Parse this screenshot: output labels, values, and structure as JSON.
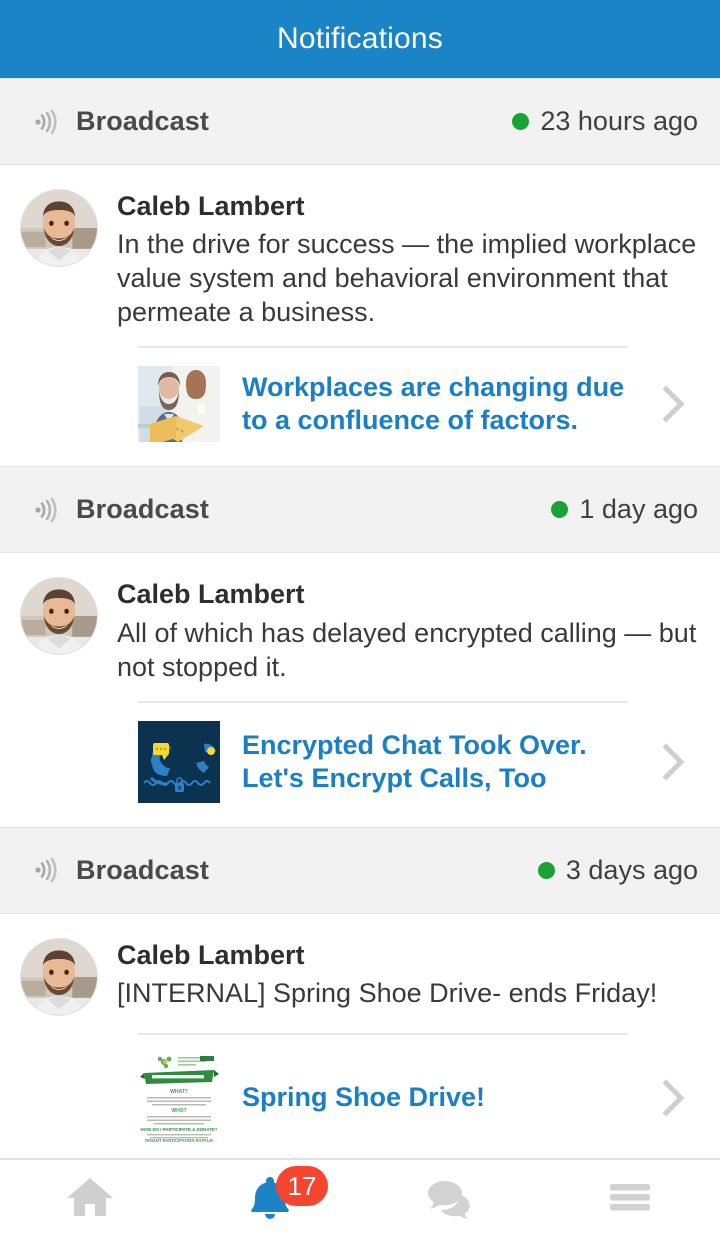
{
  "header": {
    "title": "Notifications",
    "background_color": "#1b84c6",
    "text_color": "#ffffff"
  },
  "colors": {
    "accent_blue": "#1b7fc4",
    "status_green": "#1aa335",
    "badge_red": "#f4452e",
    "band_gray": "#f2f2f2",
    "link_blue": "#1b7fc4"
  },
  "notifications": [
    {
      "kind_label": "Broadcast",
      "kind_icon": "broadcast-icon",
      "status_dot": "unread-dot",
      "time_ago": "23 hours ago",
      "author": "Caleb Lambert",
      "avatar_icon": "user-avatar",
      "message": "In the drive for success — the implied workplace value system and behavioral environment that permeate a business.",
      "attachment": {
        "thumbnail_icon": "office-women-photo-thumbnail",
        "title": "Workplaces are changing due to a confluence of factors.",
        "chevron_icon": "chevron-right-icon"
      }
    },
    {
      "kind_label": "Broadcast",
      "kind_icon": "broadcast-icon",
      "status_dot": "unread-dot",
      "time_ago": "1 day ago",
      "author": "Caleb Lambert",
      "avatar_icon": "user-avatar",
      "message": "All of which has delayed encrypted calling — but not stopped it.",
      "attachment": {
        "thumbnail_icon": "encrypted-phone-illustration-thumbnail",
        "title": "Encrypted Chat Took Over. Let's Encrypt Calls, Too",
        "chevron_icon": "chevron-right-icon"
      }
    },
    {
      "kind_label": "Broadcast",
      "kind_icon": "broadcast-icon",
      "status_dot": "unread-dot",
      "time_ago": "3 days ago",
      "author": "Caleb Lambert",
      "avatar_icon": "user-avatar",
      "message": "[INTERNAL] Spring Shoe Drive- ends Friday!",
      "attachment": {
        "thumbnail_icon": "shoe-drive-flyer-thumbnail",
        "title": "Spring Shoe Drive!",
        "chevron_icon": "chevron-right-icon"
      }
    }
  ],
  "bottom_nav": {
    "items": [
      {
        "name": "home",
        "icon": "home-icon",
        "active": false,
        "badge": null
      },
      {
        "name": "notifications",
        "icon": "bell-icon",
        "active": true,
        "badge": "17"
      },
      {
        "name": "messages",
        "icon": "chat-bubbles-icon",
        "active": false,
        "badge": null
      },
      {
        "name": "menu",
        "icon": "hamburger-menu-icon",
        "active": false,
        "badge": null
      }
    ]
  }
}
